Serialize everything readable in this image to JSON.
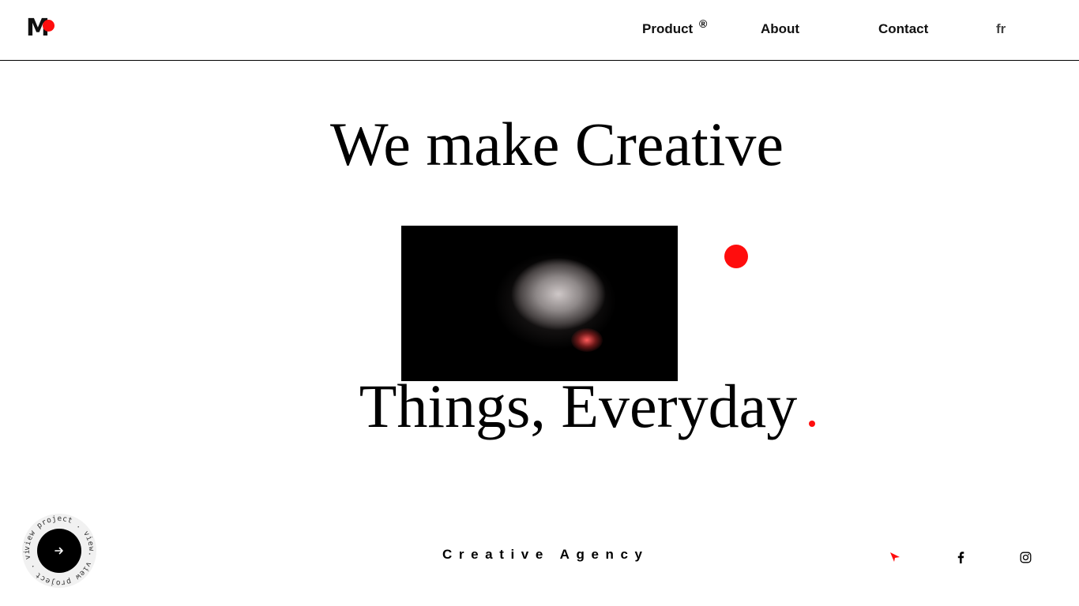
{
  "header": {
    "logo": {
      "letter": "M",
      "accent_color": "#ff0d0d"
    },
    "nav": {
      "product": "Product",
      "product_mark": "®",
      "about": "About",
      "contact": "Contact",
      "language": "fr"
    }
  },
  "hero": {
    "line1": "We make Creative",
    "line2": "Things, Everyday",
    "accent_color": "#ff0d0d"
  },
  "footer": {
    "tagline": "Creative Agency",
    "badge_ring_text": "view project . view. view project . view.",
    "badge_icon": "arrow-right-icon",
    "social_icons": [
      "send-icon",
      "facebook-icon",
      "instagram-icon"
    ]
  }
}
